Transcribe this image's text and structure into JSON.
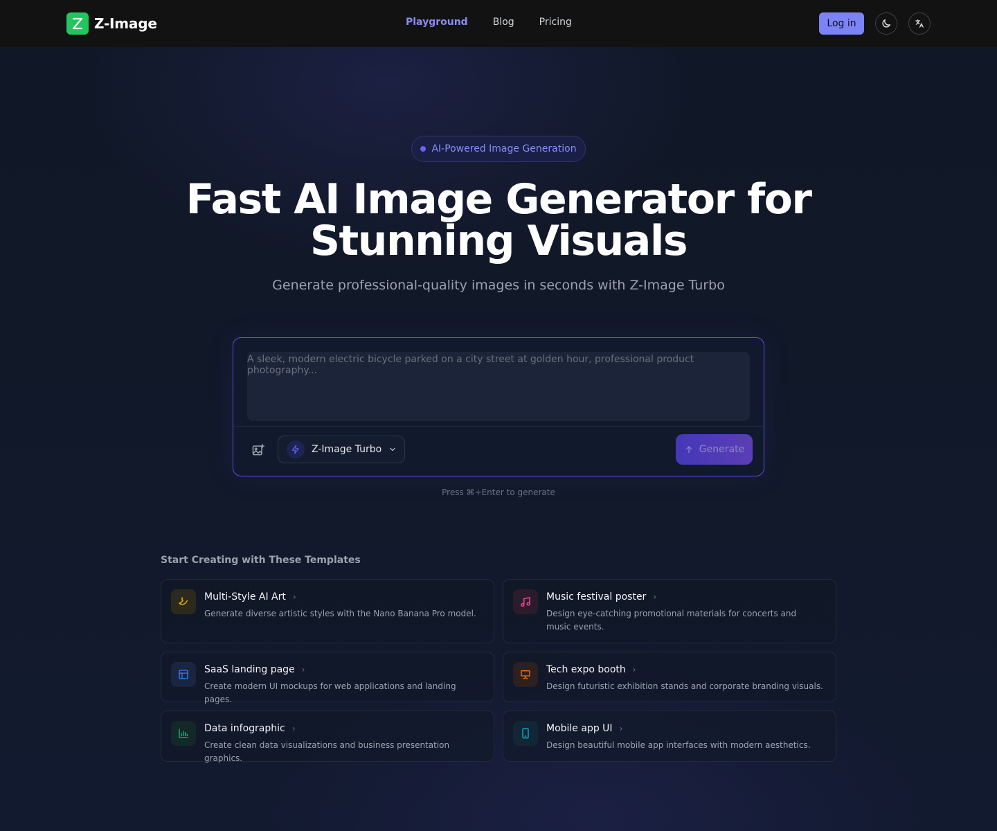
{
  "nav": {
    "brand": "Z-Image",
    "links": [
      {
        "label": "Playground",
        "active": true
      },
      {
        "label": "Blog",
        "active": false
      },
      {
        "label": "Pricing",
        "active": false
      }
    ],
    "login_label": "Log in",
    "theme_icon": "moon-icon",
    "language_icon": "translate-icon"
  },
  "hero": {
    "badge": "AI-Powered Image Generation",
    "title_line1": "Fast AI Image Generator for",
    "title_line2": "Stunning Visuals",
    "subtitle": "Generate professional-quality images in seconds with Z-Image Turbo"
  },
  "prompt": {
    "placeholder": "A sleek, modern electric bicycle parked on a city street at golden hour, professional product photography...",
    "value": "",
    "model": "Z-Image Turbo",
    "generate_label": "Generate",
    "hint": "Press ⌘+Enter to generate"
  },
  "templates": {
    "heading": "Start Creating with These Templates",
    "items": [
      {
        "title": "Multi-Style AI Art",
        "desc": "Generate diverse artistic styles with the Nano Banana Pro model.",
        "icon": "banana-icon",
        "color": "#eab308"
      },
      {
        "title": "Music festival poster",
        "desc": "Design eye-catching promotional materials for concerts and music events.",
        "icon": "music-note-icon",
        "color": "#ec4899"
      },
      {
        "title": "SaaS landing page",
        "desc": "Create modern UI mockups for web applications and landing pages.",
        "icon": "layout-icon",
        "color": "#3b82f6"
      },
      {
        "title": "Tech expo booth",
        "desc": "Design futuristic exhibition stands and corporate branding visuals.",
        "icon": "presentation-icon",
        "color": "#f97316"
      },
      {
        "title": "Data infographic",
        "desc": "Create clean data visualizations and business presentation graphics.",
        "icon": "bar-chart-icon",
        "color": "#10b981"
      },
      {
        "title": "Mobile app UI",
        "desc": "Design beautiful mobile app interfaces with modern aesthetics.",
        "icon": "smartphone-icon",
        "color": "#06b6d4"
      }
    ]
  },
  "colors": {
    "accent": "#7c83f6",
    "brand_green": "#22c55e",
    "prompt_border": "#5b4fe0"
  }
}
